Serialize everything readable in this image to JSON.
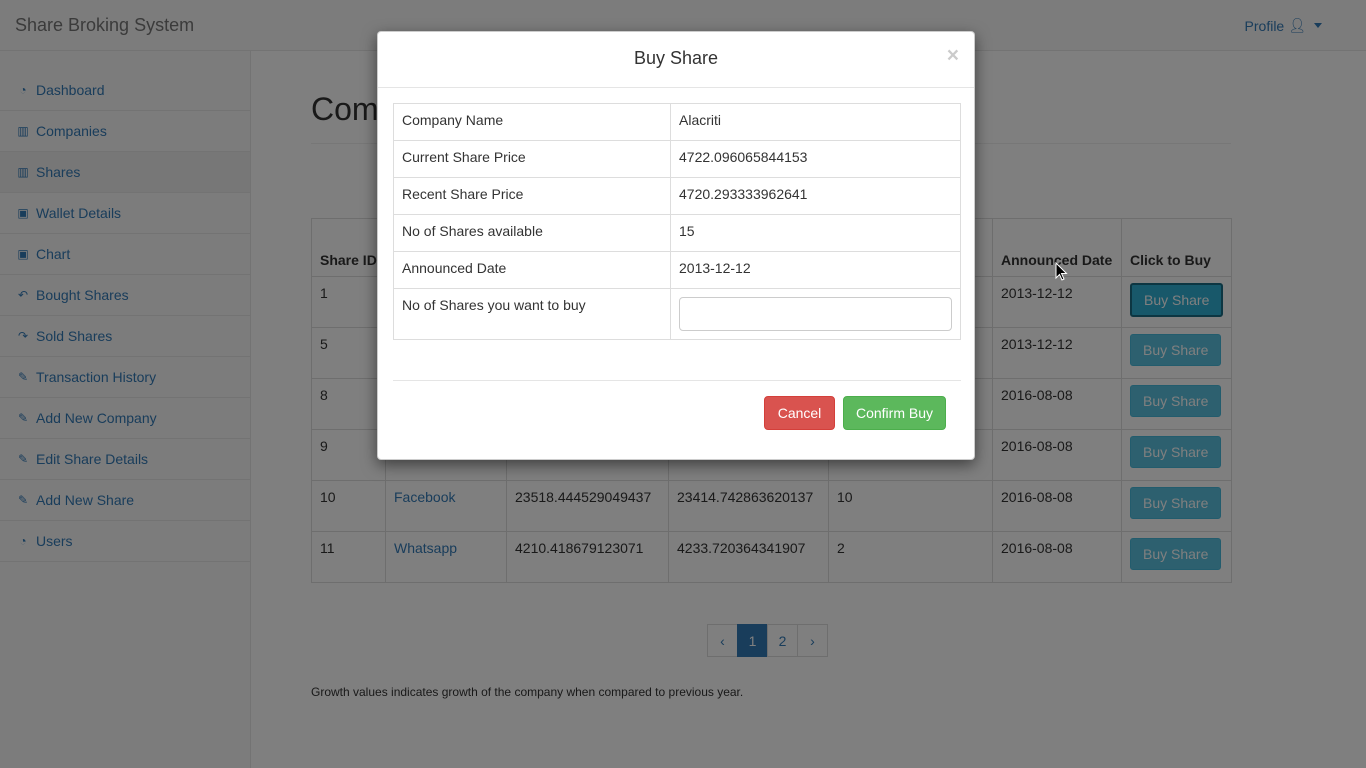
{
  "navbar": {
    "brand": "Share Broking System",
    "profile_label": "Profile",
    "profile_icon": "user-icon"
  },
  "sidebar": {
    "items": [
      {
        "label": "Dashboard",
        "icon": "dashboard-icon",
        "glyph": "◔"
      },
      {
        "label": "Companies",
        "icon": "building-icon",
        "glyph": "▥"
      },
      {
        "label": "Shares",
        "icon": "building-icon",
        "glyph": "▥",
        "active": true
      },
      {
        "label": "Wallet Details",
        "icon": "money-icon",
        "glyph": "▣"
      },
      {
        "label": "Chart",
        "icon": "money-icon",
        "glyph": "▣"
      },
      {
        "label": "Bought Shares",
        "icon": "reply-icon",
        "glyph": "↶"
      },
      {
        "label": "Sold Shares",
        "icon": "share-icon",
        "glyph": "↷"
      },
      {
        "label": "Transaction History",
        "icon": "edit-icon",
        "glyph": "✎"
      },
      {
        "label": "Add New Company",
        "icon": "edit-icon",
        "glyph": "✎"
      },
      {
        "label": "Edit Share Details",
        "icon": "edit-icon",
        "glyph": "✎"
      },
      {
        "label": "Add New Share",
        "icon": "edit-icon",
        "glyph": "✎"
      },
      {
        "label": "Users",
        "icon": "dashboard-icon",
        "glyph": "◔"
      }
    ]
  },
  "main": {
    "title": "Comp",
    "table": {
      "headers": [
        "Share ID",
        "",
        "",
        "",
        "",
        "Announced Date",
        "Click to Buy"
      ],
      "rows": [
        {
          "id": "1",
          "company": "",
          "current": "",
          "recent": "",
          "available": "",
          "date": "2013-12-12",
          "button": "Buy Share",
          "focused": true
        },
        {
          "id": "5",
          "company": "",
          "current": "",
          "recent": "",
          "available": "",
          "date": "2013-12-12",
          "button": "Buy Share"
        },
        {
          "id": "8",
          "company": "",
          "current": "",
          "recent": "",
          "available": "",
          "date": "2016-08-08",
          "button": "Buy Share"
        },
        {
          "id": "9",
          "company": "",
          "current": "",
          "recent": "",
          "available": "",
          "date": "2016-08-08",
          "button": "Buy Share"
        },
        {
          "id": "10",
          "company": "Facebook",
          "current": "23518.444529049437",
          "recent": "23414.742863620137",
          "available": "10",
          "date": "2016-08-08",
          "button": "Buy Share"
        },
        {
          "id": "11",
          "company": "Whatsapp",
          "current": "4210.418679123071",
          "recent": "4233.720364341907",
          "available": "2",
          "date": "2016-08-08",
          "button": "Buy Share"
        }
      ]
    },
    "pagination": {
      "prev": "‹",
      "pages": [
        "1",
        "2"
      ],
      "active": "1",
      "next": "›"
    },
    "note": "Growth values indicates growth of the company when compared to previous year."
  },
  "modal": {
    "title": "Buy Share",
    "close": "×",
    "rows": [
      {
        "label": "Company Name",
        "value": "Alacriti"
      },
      {
        "label": "Current Share Price",
        "value": "4722.096065844153"
      },
      {
        "label": "Recent Share Price",
        "value": "4720.293333962641"
      },
      {
        "label": "No of Shares available",
        "value": "15"
      },
      {
        "label": "Announced Date",
        "value": "2013-12-12"
      }
    ],
    "quantity_label": "No of Shares you want to buy",
    "quantity_value": "",
    "cancel_label": "Cancel",
    "confirm_label": "Confirm Buy"
  },
  "colors": {
    "link": "#337ab7",
    "info": "#5bc0de",
    "danger": "#d9534f",
    "success": "#5cb85c"
  }
}
